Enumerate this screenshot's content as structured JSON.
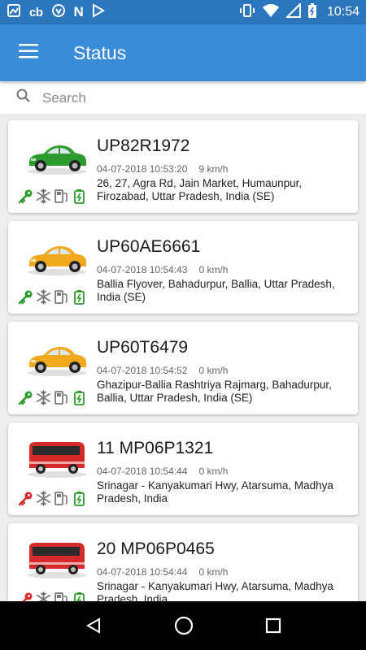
{
  "status_bar": {
    "notif_text": "cb",
    "notif_letter": "N",
    "time": "10:54"
  },
  "app_bar": {
    "title": "Status",
    "menu_icon": "hamburger-menu-icon"
  },
  "search": {
    "placeholder": "Search"
  },
  "vehicles": [
    {
      "plate": "UP82R1972",
      "datetime": "04-07-2018 10:53:20",
      "speed": "9 km/h",
      "address": "26, 27, Agra Rd, Jain Market, Humaunpur, Firozabad, Uttar Pradesh, India (SE)",
      "vehicle_type": "car",
      "vehicle_color": "#2e9b2e",
      "ignition_color": "#2a9a2a"
    },
    {
      "plate": "UP60AE6661",
      "datetime": "04-07-2018 10:54:43",
      "speed": "0 km/h",
      "address": "Ballia Flyover, Bahadurpur, Ballia, Uttar Pradesh, India (SE)",
      "vehicle_type": "car",
      "vehicle_color": "#f0a81c",
      "ignition_color": "#2a9a2a"
    },
    {
      "plate": "UP60T6479",
      "datetime": "04-07-2018 10:54:52",
      "speed": "0 km/h",
      "address": "Ghazipur-Ballia Rashtriya Rajmarg, Bahadurpur, Ballia, Uttar Pradesh, India (SE)",
      "vehicle_type": "car",
      "vehicle_color": "#f0a81c",
      "ignition_color": "#2a9a2a"
    },
    {
      "plate": "11 MP06P1321",
      "datetime": "04-07-2018 10:54:44",
      "speed": "0 km/h",
      "address": "Srinagar - Kanyakumari Hwy, Atarsuma, Madhya Pradesh, India",
      "vehicle_type": "bus",
      "vehicle_color": "#d62a2a",
      "ignition_color": "#d62a2a"
    },
    {
      "plate": "20 MP06P0465",
      "datetime": "04-07-2018 10:54:44",
      "speed": "0 km/h",
      "address": "Srinagar - Kanyakumari Hwy, Atarsuma, Madhya Pradesh, India",
      "vehicle_type": "bus",
      "vehicle_color": "#d62a2a",
      "ignition_color": "#d62a2a"
    }
  ],
  "colors": {
    "status_bar": "#2b76bd",
    "app_bar": "#3a8bd8",
    "status_green": "#2a9a2a",
    "status_gray": "#7a7a7a"
  }
}
